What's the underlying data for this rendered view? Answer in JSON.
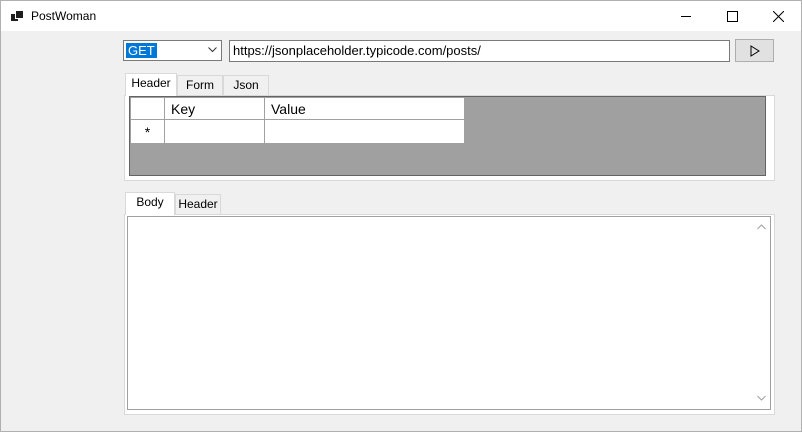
{
  "window": {
    "title": "PostWoman"
  },
  "request": {
    "method": "GET",
    "url": "https://jsonplaceholder.typicode.com/posts/",
    "send_icon": "play-icon"
  },
  "request_tabs": [
    {
      "label": "Header",
      "active": true
    },
    {
      "label": "Form",
      "active": false
    },
    {
      "label": "Json",
      "active": false
    }
  ],
  "header_grid": {
    "columns": [
      "Key",
      "Value"
    ],
    "new_row_marker": "*"
  },
  "response_tabs": [
    {
      "label": "Body",
      "active": true
    },
    {
      "label": "Header",
      "active": false
    }
  ],
  "response_body": "",
  "colors": {
    "accent": "#0078d7",
    "grid_background": "#a0a0a0",
    "window_background": "#f0f0f0"
  }
}
